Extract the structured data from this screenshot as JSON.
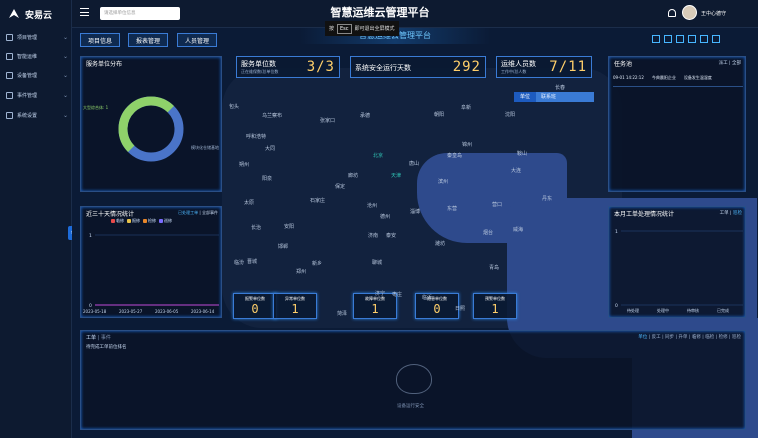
{
  "app": {
    "logo": "安易云",
    "title": "智慧运维云管理平台",
    "subtitle": "智慧运维云管理平台"
  },
  "search": {
    "placeholder": "请选择单位信息"
  },
  "esc_hint": {
    "prefix": "按",
    "key": "Esc",
    "text": "即可退出全屏模式"
  },
  "user": {
    "name": "王中心德守"
  },
  "sidebar": {
    "items": [
      {
        "label": "项目管理",
        "icon": "home-icon"
      },
      {
        "label": "智能运维",
        "icon": "monitor-icon"
      },
      {
        "label": "设备管理",
        "icon": "device-icon"
      },
      {
        "label": "事件管理",
        "icon": "event-icon"
      },
      {
        "label": "系统设置",
        "icon": "settings-icon"
      }
    ]
  },
  "tabs": [
    "项目信息",
    "报表管理",
    "人员管理"
  ],
  "panels": {
    "service_dist": {
      "title": "服务单位分布",
      "label1": "大型综合体: 1",
      "label2": "模块化仓储基地"
    },
    "tasks": {
      "title": "任务池",
      "links": [
        "派工",
        "全部"
      ],
      "row": {
        "time": "09-01 14:22:12",
        "unit": "今典晨阳企业",
        "status": "设备发生温湿度"
      }
    },
    "trend30": {
      "title": "近三十天情况统计",
      "links": [
        "已处理工单",
        "全部事件"
      ],
      "legend": [
        "临修",
        "报修",
        "检修",
        "巡修"
      ],
      "legend_colors": [
        "#e84a4a",
        "#e8c34a",
        "#e8862a",
        "#7a6cff"
      ],
      "y_labels": [
        "1",
        "0"
      ],
      "x_labels": [
        "2023-05-18",
        "2023-05-27",
        "2023-06-05",
        "2023-06-14"
      ]
    },
    "month_work": {
      "title": "本月工单处理情况统计",
      "links": [
        "工单",
        "巡检"
      ],
      "y_labels": [
        "1",
        "0"
      ],
      "x_labels": [
        "待处理",
        "处理中",
        "待审核",
        "已完成"
      ]
    },
    "workorder": {
      "title": "工单",
      "title2": "| 事件",
      "header_links": [
        "单位",
        "反工",
        "同步",
        "升单",
        "临修",
        "临检",
        "检修",
        "巡检"
      ],
      "row": "待完成工单前位排名",
      "watermark": "设备运行安全"
    }
  },
  "stats": [
    {
      "label": "服务单位数",
      "sub": "正在维保数/总单位数",
      "value": "3/3"
    },
    {
      "label": "系统安全运行天数",
      "sub": "",
      "value": "292"
    },
    {
      "label": "运维人员数",
      "sub": "工作中/总人数",
      "value": "7/11"
    }
  ],
  "toggle": {
    "unit": "单位",
    "other": "联系班"
  },
  "counters": [
    {
      "label": "报警单位数",
      "value": "0"
    },
    {
      "label": "异常单位数",
      "value": "1"
    },
    {
      "label": "故障单位数",
      "value": "1"
    },
    {
      "label": "隐患单位数",
      "value": "0"
    },
    {
      "label": "预警单位数",
      "value": "1"
    }
  ],
  "donut": {
    "segments": [
      {
        "value": 1,
        "color": "#8fd16a"
      },
      {
        "value": 1,
        "color": "#4a74c8"
      }
    ]
  },
  "map": {
    "cities": [
      "北京",
      "天津",
      "石家庄",
      "太原",
      "济南",
      "郑州",
      "大连",
      "沈阳",
      "呼和浩特",
      "唐山",
      "保定",
      "邯郸",
      "潍坊",
      "青岛",
      "烟台",
      "临沂",
      "济宁",
      "日照",
      "德州",
      "沧州",
      "秦皇岛",
      "承德",
      "张家口",
      "大同",
      "廊坊",
      "菏泽",
      "营口",
      "锦州",
      "丹东",
      "鞍山",
      "朝阳",
      "阜新",
      "长治",
      "晋城",
      "安阳",
      "新乡",
      "聊城",
      "临汾",
      "淄博",
      "东营",
      "威海",
      "滨州",
      "泰安",
      "枣庄",
      "乌兰察布",
      "包头",
      "朔州",
      "阳泉",
      "长春"
    ]
  }
}
